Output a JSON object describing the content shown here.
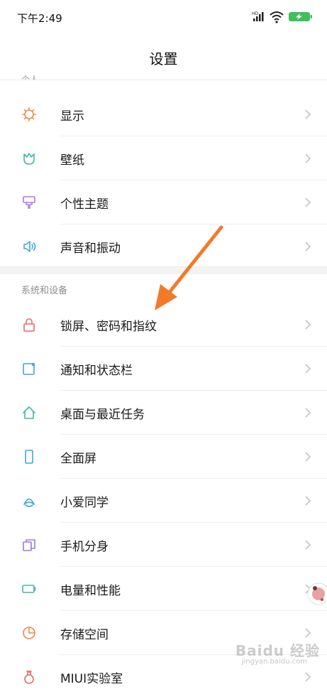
{
  "status_bar": {
    "time": "下午2:49",
    "signal_badge": "HD",
    "battery_icon": "battery-charging-icon",
    "wifi_icon": "wifi-icon"
  },
  "header": {
    "title": "设置"
  },
  "sections": {
    "personal_title_cut": "个人",
    "system_title": "系统和设备"
  },
  "items": [
    {
      "label": "显示",
      "icon": "sun-icon",
      "color": "#f08a4b"
    },
    {
      "label": "壁纸",
      "icon": "tulip-icon",
      "color": "#3fb8a3"
    },
    {
      "label": "个性主题",
      "icon": "brush-icon",
      "color": "#b07ad9"
    },
    {
      "label": "声音和振动",
      "icon": "speaker-icon",
      "color": "#3da8d8"
    },
    {
      "label": "锁屏、密码和指纹",
      "icon": "lock-icon",
      "color": "#e46a6a"
    },
    {
      "label": "通知和状态栏",
      "icon": "notification-icon",
      "color": "#3da8d8"
    },
    {
      "label": "桌面与最近任务",
      "icon": "home-icon",
      "color": "#3fb8a3"
    },
    {
      "label": "全面屏",
      "icon": "phone-icon",
      "color": "#3da8d8"
    },
    {
      "label": "小爱同学",
      "icon": "xiaoai-icon",
      "color": "#3da8d8"
    },
    {
      "label": "手机分身",
      "icon": "dual-icon",
      "color": "#9b7ad9"
    },
    {
      "label": "电量和性能",
      "icon": "battery-icon",
      "color": "#3fb8a3"
    },
    {
      "label": "存储空间",
      "icon": "storage-icon",
      "color": "#f08a4b"
    },
    {
      "label": "MIUI实验室",
      "icon": "flask-icon",
      "color": "#e46a6a"
    }
  ],
  "watermark": {
    "text": "Baidu 经验",
    "sub": "jingyan.baidu.com"
  },
  "annotation_arrow_color": "#f27a2a"
}
